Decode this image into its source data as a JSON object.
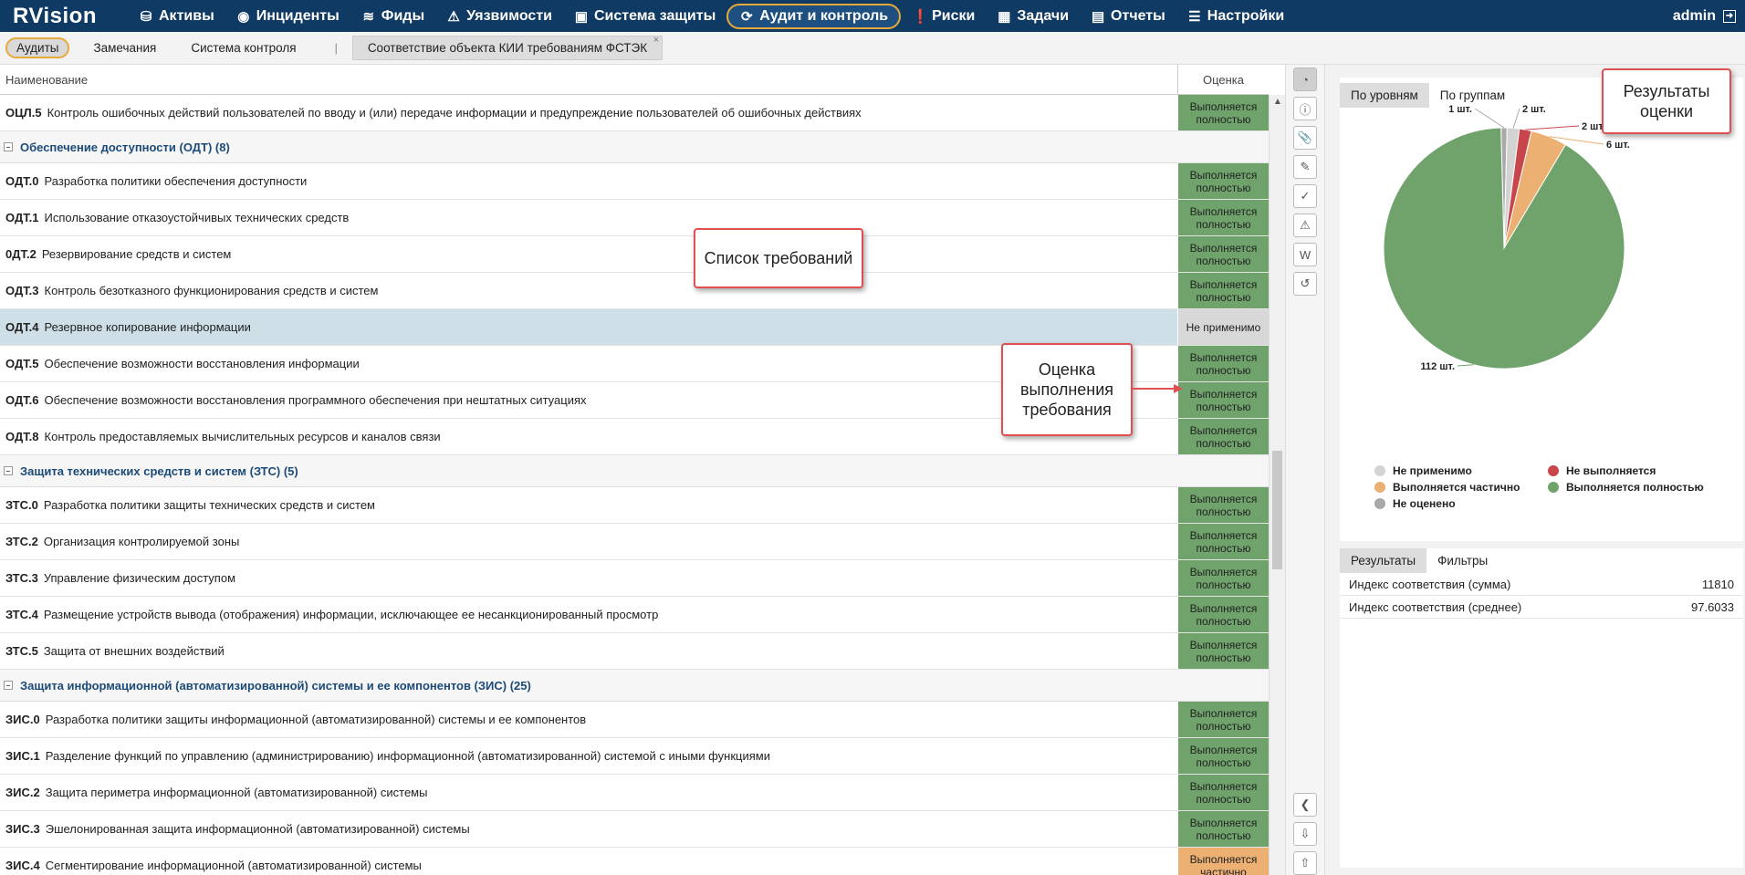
{
  "app": {
    "logo": "RVision",
    "user": "admin"
  },
  "nav": {
    "items": [
      {
        "label": "Активы",
        "icon": "database-icon"
      },
      {
        "label": "Инциденты",
        "icon": "target-icon"
      },
      {
        "label": "Фиды",
        "icon": "rss-icon"
      },
      {
        "label": "Уязвимости",
        "icon": "warning-icon"
      },
      {
        "label": "Система защиты",
        "icon": "shield-blocks-icon"
      },
      {
        "label": "Аудит и контроль",
        "icon": "refresh-icon",
        "active": true
      },
      {
        "label": "Риски",
        "icon": "alert-circle-icon"
      },
      {
        "label": "Задачи",
        "icon": "calendar-icon"
      },
      {
        "label": "Отчеты",
        "icon": "report-icon"
      },
      {
        "label": "Настройки",
        "icon": "menu-icon"
      }
    ]
  },
  "subnav": {
    "tabs": [
      "Аудиты",
      "Замечания",
      "Система контроля"
    ],
    "separator": "|",
    "doc_tab": "Соответствие объекта КИИ требованиям ФСТЭК",
    "close": "×"
  },
  "table": {
    "headers": {
      "name": "Наименование",
      "score": "Оценка"
    },
    "rows": [
      {
        "type": "row",
        "code": "ОЦЛ.5",
        "name": "Контроль ошибочных действий пользователей по вводу и (или) передаче информации и предупреждение пользователей об ошибочных действиях",
        "score": "Выполняется полностью",
        "status": "full"
      },
      {
        "type": "group",
        "name": "Обеспечение доступности (ОДТ) (8)"
      },
      {
        "type": "row",
        "code": "ОДТ.0",
        "name": "Разработка политики обеспечения доступности",
        "score": "Выполняется полностью",
        "status": "full"
      },
      {
        "type": "row",
        "code": "ОДТ.1",
        "name": "Использование отказоустойчивых технических средств",
        "score": "Выполняется полностью",
        "status": "full"
      },
      {
        "type": "row",
        "code": "0ДТ.2",
        "name": "Резервирование средств и систем",
        "score": "Выполняется полностью",
        "status": "full"
      },
      {
        "type": "row",
        "code": "ОДТ.3",
        "name": "Контроль безотказного функционирования средств и систем",
        "score": "Выполняется полностью",
        "status": "full"
      },
      {
        "type": "row",
        "code": "ОДТ.4",
        "name": "Резервное копирование информации",
        "score": "Не применимо",
        "status": "na",
        "selected": true
      },
      {
        "type": "row",
        "code": "ОДТ.5",
        "name": "Обеспечение возможности восстановления информации",
        "score": "Выполняется полностью",
        "status": "full"
      },
      {
        "type": "row",
        "code": "ОДТ.6",
        "name": "Обеспечение возможности восстановления программного обеспечения при нештатных ситуациях",
        "score": "Выполняется полностью",
        "status": "full"
      },
      {
        "type": "row",
        "code": "ОДТ.8",
        "name": "Контроль предоставляемых вычислительных ресурсов и каналов связи",
        "score": "Выполняется полностью",
        "status": "full"
      },
      {
        "type": "group",
        "name": "Защита технических средств и систем (ЗТС) (5)"
      },
      {
        "type": "row",
        "code": "ЗТС.0",
        "name": "Разработка политики защиты технических средств и систем",
        "score": "Выполняется полностью",
        "status": "full"
      },
      {
        "type": "row",
        "code": "ЗТС.2",
        "name": "Организация контролируемой зоны",
        "score": "Выполняется полностью",
        "status": "full"
      },
      {
        "type": "row",
        "code": "ЗТС.3",
        "name": "Управление физическим доступом",
        "score": "Выполняется полностью",
        "status": "full"
      },
      {
        "type": "row",
        "code": "ЗТС.4",
        "name": "Размещение устройств вывода (отображения) информации, исключающее ее несанкционированный просмотр",
        "score": "Выполняется полностью",
        "status": "full"
      },
      {
        "type": "row",
        "code": "ЗТС.5",
        "name": "Защита от внешних воздействий",
        "score": "Выполняется полностью",
        "status": "full"
      },
      {
        "type": "group",
        "name": "Защита информационной (автоматизированной) системы и ее компонентов (ЗИС) (25)"
      },
      {
        "type": "row",
        "code": "ЗИС.0",
        "name": "Разработка политики защиты информационной (автоматизированной) системы и ее компонентов",
        "score": "Выполняется полностью",
        "status": "full"
      },
      {
        "type": "row",
        "code": "ЗИС.1",
        "name": "Разделение функций по управлению (администрированию) информационной (автоматизированной) системой с иными функциями",
        "score": "Выполняется полностью",
        "status": "full"
      },
      {
        "type": "row",
        "code": "ЗИС.2",
        "name": "Защита периметра информационной (автоматизированной) системы",
        "score": "Выполняется полностью",
        "status": "full"
      },
      {
        "type": "row",
        "code": "ЗИС.3",
        "name": "Эшелонированная защита информационной (автоматизированной) системы",
        "score": "Выполняется полностью",
        "status": "full"
      },
      {
        "type": "row",
        "code": "ЗИС.4",
        "name": "Сегментирование информационной (автоматизированной) системы",
        "score": "Выполняется частично",
        "status": "part"
      }
    ]
  },
  "tools": [
    "pie-chart-icon",
    "info-icon",
    "paperclip-icon",
    "comment-icon",
    "clipboard-check-icon",
    "warning-icon",
    "word-doc-icon",
    "history-icon",
    "collapse-left-icon",
    "download-icon",
    "upload-icon"
  ],
  "chart_panel": {
    "tabs": [
      "По уровням",
      "По группам"
    ]
  },
  "chart_data": {
    "type": "pie",
    "slices": [
      {
        "label": "Выполняется полностью",
        "value": 112,
        "text": "112 шт.",
        "color": "#6fa36b"
      },
      {
        "label": "Не оценено",
        "value": 1,
        "text": "1 шт.",
        "color": "#a9a9a9"
      },
      {
        "label": "Не применимо",
        "value": 2,
        "text": "2 шт.",
        "color": "#d3d3d3"
      },
      {
        "label": "Не выполняется",
        "value": 2,
        "text": "2 шт.",
        "color": "#c8464b"
      },
      {
        "label": "Выполняется частично",
        "value": 6,
        "text": "6 шт.",
        "color": "#ecb073"
      }
    ],
    "legend": [
      {
        "label": "Не применимо",
        "color": "#d3d3d3"
      },
      {
        "label": "Не выполняется",
        "color": "#c8464b"
      },
      {
        "label": "Выполняется частично",
        "color": "#ecb073"
      },
      {
        "label": "Выполняется полностью",
        "color": "#6fa36b"
      },
      {
        "label": "Не оценено",
        "color": "#a9a9a9"
      }
    ]
  },
  "results": {
    "tabs": [
      "Результаты",
      "Фильтры"
    ],
    "rows": [
      {
        "label": "Индекс соответствия (сумма)",
        "value": "11810"
      },
      {
        "label": "Индекс соответствия (среднее)",
        "value": "97.6033"
      }
    ]
  },
  "callouts": {
    "requirements": "Список требований",
    "assessment": "Оценка выполнения требования",
    "results": "Результаты оценки"
  }
}
